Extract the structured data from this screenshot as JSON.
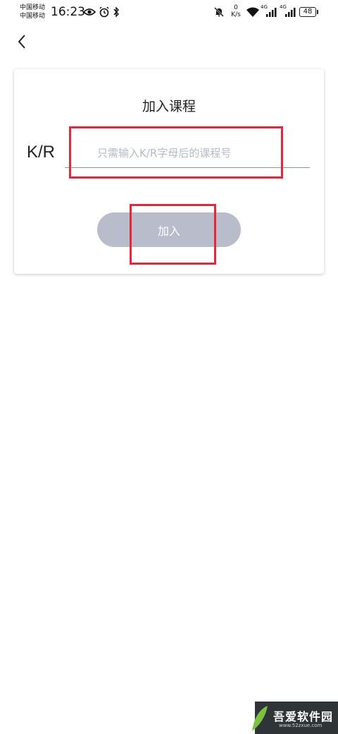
{
  "status_bar": {
    "carrier_1": "中国移动",
    "carrier_2": "中国移动",
    "time": "16:23",
    "net_speed_value": "0",
    "net_speed_unit": "K/s",
    "signal_1_label": "4G",
    "signal_2_label": "4G",
    "battery": "48"
  },
  "card": {
    "title": "加入课程",
    "prefix": "K/R",
    "input_placeholder": "只需输入K/R字母后的课程号",
    "input_value": "",
    "join_label": "加入"
  },
  "colors": {
    "highlight": "#e2283a",
    "button_disabled": "#b9bccb",
    "placeholder": "#b4bcc8"
  },
  "icons": {
    "back": "chevron-left-icon",
    "eye": "eye-icon",
    "alarm": "alarm-icon",
    "bluetooth": "bluetooth-icon",
    "mute": "bell-off-icon",
    "wifi": "wifi-icon",
    "signal": "signal-bars-icon"
  },
  "watermark": {
    "text": "吾爱软件园",
    "url": "www.52zxue.com"
  }
}
